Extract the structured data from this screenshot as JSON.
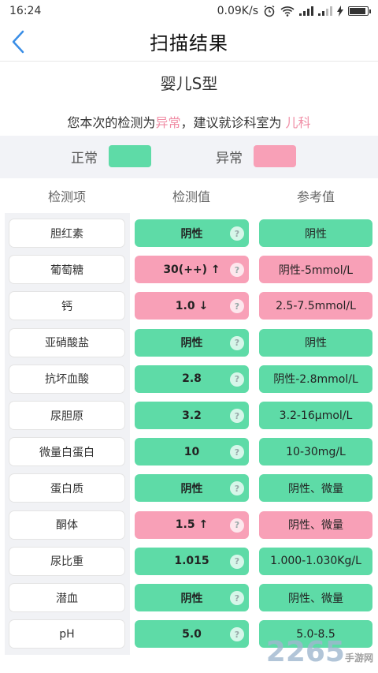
{
  "status_bar": {
    "time": "16:24",
    "speed": "0.09K/s"
  },
  "header": {
    "title": "扫描结果"
  },
  "subtitle": "婴儿S型",
  "suggestion": {
    "prefix": "您本次的检测为",
    "status": "异常",
    "middle": "，建议就诊科室为 ",
    "department": "儿科"
  },
  "legend": {
    "normal_label": "正常",
    "abnormal_label": "异常",
    "normal_color": "#5edba7",
    "abnormal_color": "#f8a0b7"
  },
  "columns": {
    "item": "检测项",
    "value": "检测值",
    "reference": "参考值"
  },
  "rows": [
    {
      "name": "胆红素",
      "value": "阴性",
      "reference": "阴性",
      "status": "normal"
    },
    {
      "name": "葡萄糖",
      "value": "30(++) ↑",
      "reference": "阴性-5mmol/L",
      "status": "abnormal"
    },
    {
      "name": "钙",
      "value": "1.0 ↓",
      "reference": "2.5-7.5mmol/L",
      "status": "abnormal"
    },
    {
      "name": "亚硝酸盐",
      "value": "阴性",
      "reference": "阴性",
      "status": "normal"
    },
    {
      "name": "抗坏血酸",
      "value": "2.8",
      "reference": "阴性-2.8mmol/L",
      "status": "normal"
    },
    {
      "name": "尿胆原",
      "value": "3.2",
      "reference": "3.2-16μmol/L",
      "status": "normal"
    },
    {
      "name": "微量白蛋白",
      "value": "10",
      "reference": "10-30mg/L",
      "status": "normal"
    },
    {
      "name": "蛋白质",
      "value": "阴性",
      "reference": "阴性、微量",
      "status": "normal"
    },
    {
      "name": "酮体",
      "value": "1.5 ↑",
      "reference": "阴性、微量",
      "status": "abnormal"
    },
    {
      "name": "尿比重",
      "value": "1.015",
      "reference": "1.000-1.030Kg/L",
      "status": "normal"
    },
    {
      "name": "潜血",
      "value": "阴性",
      "reference": "阴性、微量",
      "status": "normal"
    },
    {
      "name": "pH",
      "value": "5.0",
      "reference": "5.0-8.5",
      "status": "normal"
    }
  ],
  "help_icon": "?",
  "watermark": {
    "number": "2265",
    "site": "手游网"
  }
}
